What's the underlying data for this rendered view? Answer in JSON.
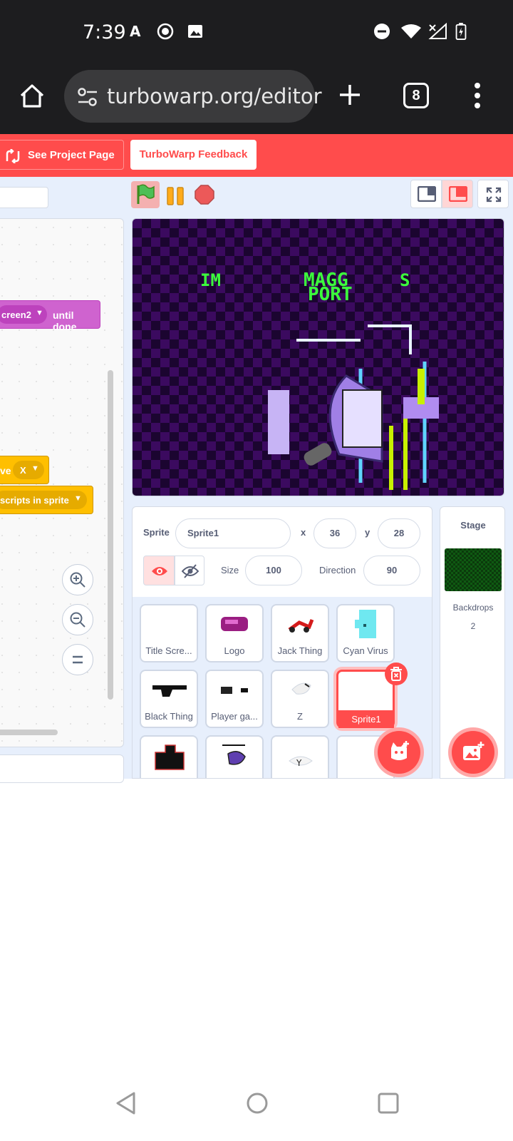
{
  "status_bar": {
    "time": "7:39"
  },
  "browser": {
    "url": "turbowarp.org/editor",
    "tab_count": "8"
  },
  "menu": {
    "see_project_page": "See Project Page",
    "feedback": "TurboWarp Feedback"
  },
  "code_blocks": {
    "purple_block_text": "creen2",
    "purple_block_suffix": "until done",
    "yellow_block1_text": "ve",
    "yellow_block1_dropdown": "X",
    "yellow_block2_text": "scripts in sprite"
  },
  "sprite_info": {
    "sprite_label": "Sprite",
    "sprite_name": "Sprite1",
    "x_label": "x",
    "x_value": "36",
    "y_label": "y",
    "y_value": "28",
    "size_label": "Size",
    "size_value": "100",
    "direction_label": "Direction",
    "direction_value": "90"
  },
  "sprites": [
    {
      "name": "Title Scre..."
    },
    {
      "name": "Logo"
    },
    {
      "name": "Jack Thing"
    },
    {
      "name": "Cyan Virus"
    },
    {
      "name": "Black Thing"
    },
    {
      "name": "Player ga..."
    },
    {
      "name": "Z"
    },
    {
      "name": "Sprite1"
    }
  ],
  "stage_panel": {
    "title": "Stage",
    "backdrops_label": "Backdrops",
    "backdrops_count": "2"
  },
  "stage_overlay": {
    "text1": "IM",
    "text2": "MAGG",
    "text3": "PORT",
    "text4": "S"
  },
  "colors": {
    "accent": "#ff4c4c",
    "workspace_bg": "#e7effc",
    "purple_block": "#cf63cf",
    "yellow_block": "#ffbf00"
  }
}
